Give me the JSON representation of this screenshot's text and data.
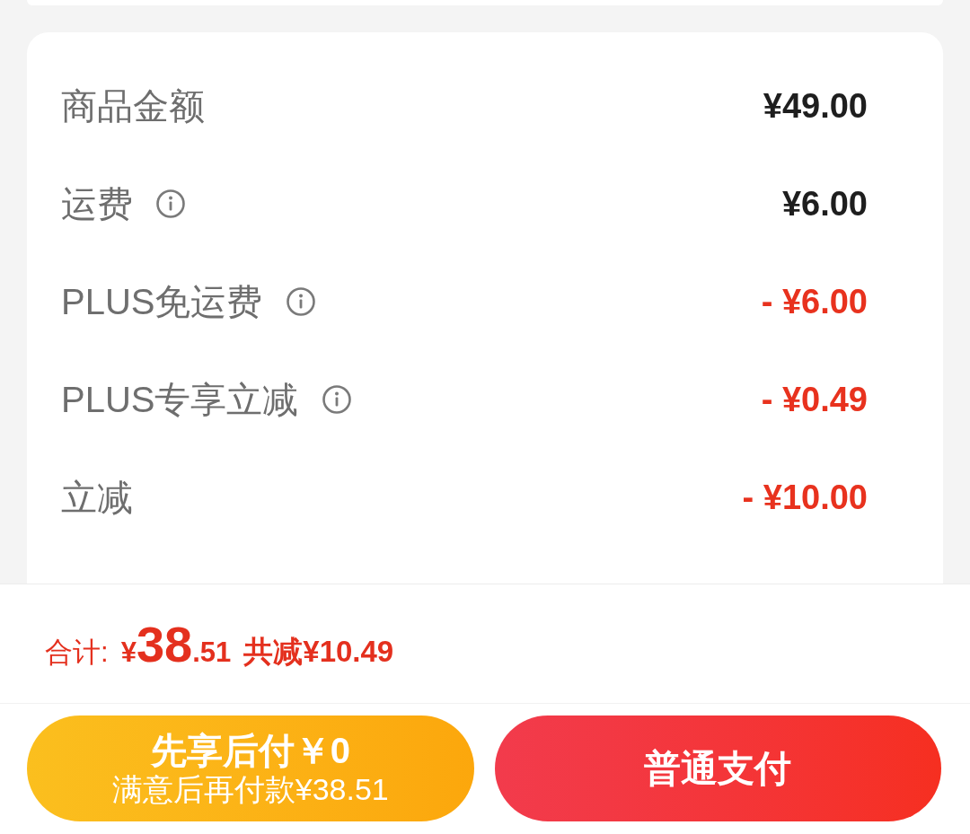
{
  "price_rows": [
    {
      "kind": "charge",
      "label": "商品金额",
      "info": false,
      "value": "¥49.00"
    },
    {
      "kind": "charge",
      "label": "运费",
      "info": true,
      "value": "¥6.00"
    },
    {
      "kind": "discount",
      "label": "PLUS免运费",
      "info": true,
      "value": "- ¥6.00"
    },
    {
      "kind": "discount",
      "label": "PLUS专享立减",
      "info": true,
      "value": "- ¥0.49"
    },
    {
      "kind": "discount",
      "label": "立减",
      "info": false,
      "value": "- ¥10.00"
    }
  ],
  "summary": {
    "label": "合计:",
    "currency": "¥",
    "amount_integer": "38",
    "amount_decimal": ".51",
    "savings": "共减¥10.49"
  },
  "buttons": [
    {
      "kind": "deferred",
      "title": "先享后付￥0",
      "subtitle": "满意后再付款¥38.51"
    },
    {
      "kind": "normal",
      "title": "普通支付"
    }
  ]
}
